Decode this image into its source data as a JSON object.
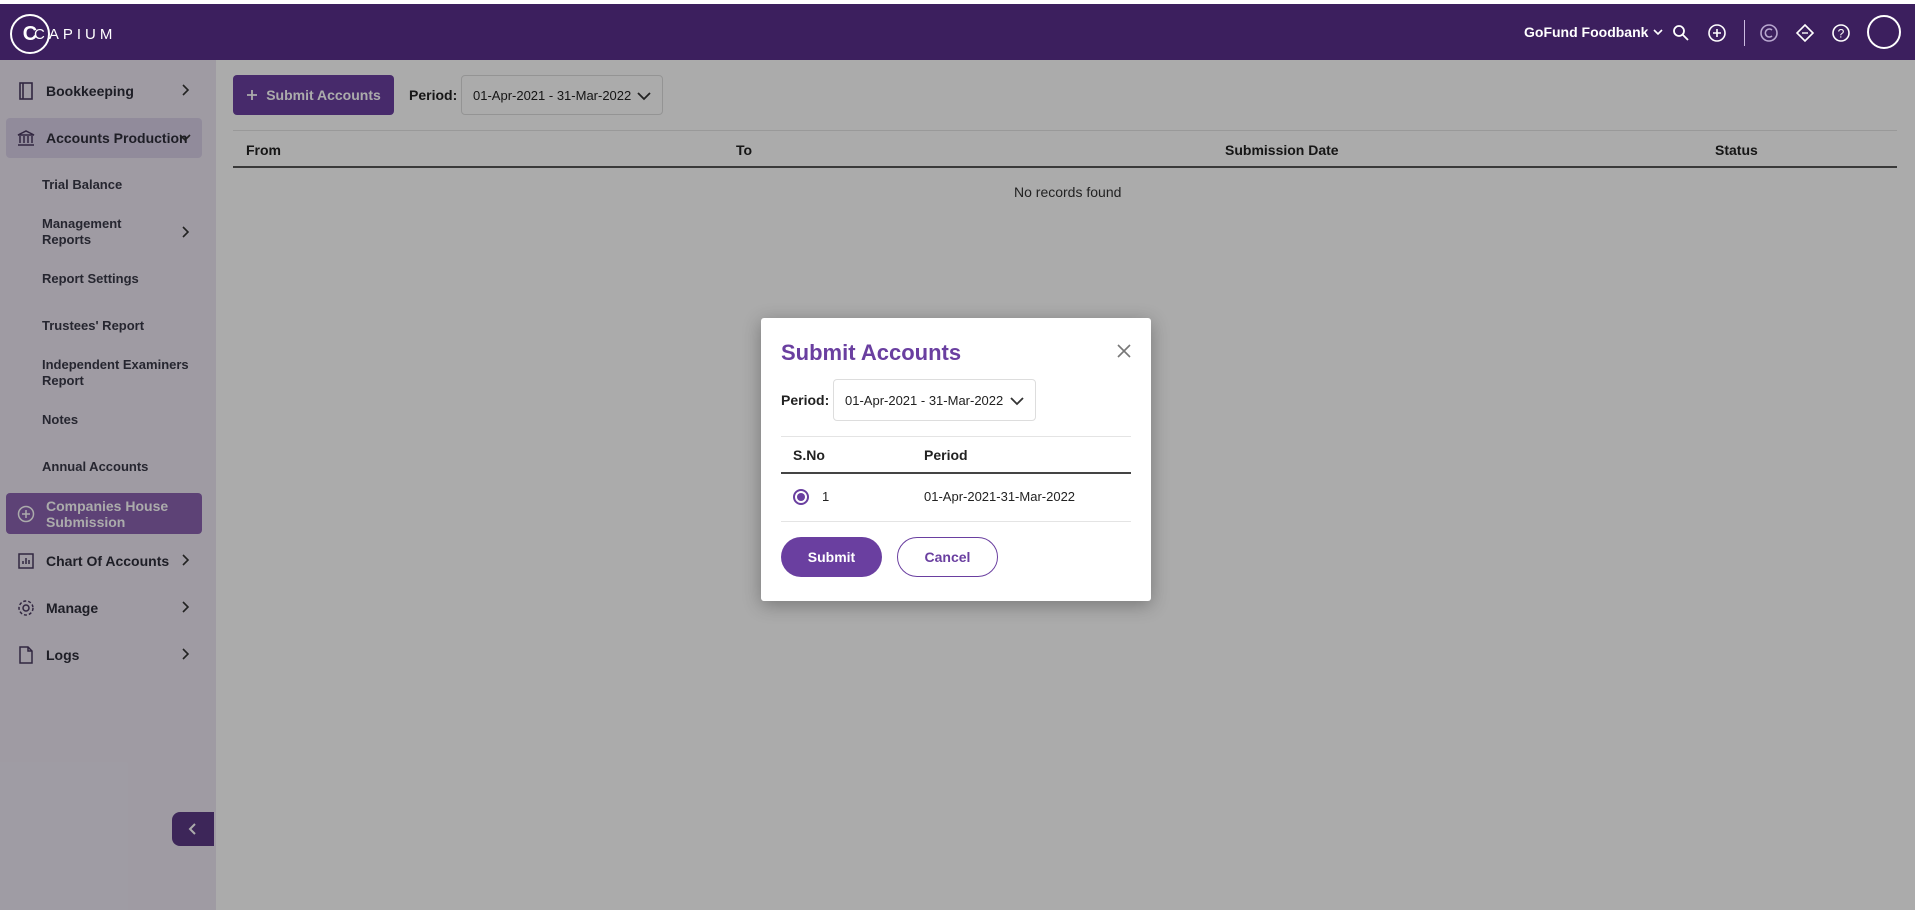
{
  "header": {
    "logo_text": "CAPIUM",
    "org_name": "GoFund Foodbank",
    "icons": [
      "search-icon",
      "add-circle-icon",
      "capium-coin-icon",
      "ticket-icon",
      "help-icon",
      "avatar"
    ]
  },
  "sidebar": {
    "items": [
      {
        "label": "Bookkeeping",
        "icon": "book-icon"
      },
      {
        "label": "Accounts Production",
        "icon": "bank-icon"
      },
      {
        "label": "Companies House Submission",
        "icon": "add-circle-icon"
      },
      {
        "label": "Chart Of Accounts",
        "icon": "chart-icon"
      },
      {
        "label": "Manage",
        "icon": "gear-icon"
      },
      {
        "label": "Logs",
        "icon": "file-icon"
      }
    ],
    "sub_items": [
      {
        "label": "Trial Balance"
      },
      {
        "label": "Management Reports"
      },
      {
        "label": "Report Settings"
      },
      {
        "label": "Trustees' Report"
      },
      {
        "label": "Independent Examiners Report"
      },
      {
        "label": "Notes"
      },
      {
        "label": "Annual Accounts"
      }
    ]
  },
  "main": {
    "submit_button": "Submit Accounts",
    "period_label": "Period:",
    "period_value": "01-Apr-2021 - 31-Mar-2022",
    "columns": [
      "From",
      "To",
      "Submission Date",
      "Status"
    ],
    "empty_text": "No records found"
  },
  "modal": {
    "title": "Submit Accounts",
    "period_label": "Period:",
    "period_value": "01-Apr-2021 - 31-Mar-2022",
    "columns": [
      "S.No",
      "Period"
    ],
    "rows": [
      {
        "sno": "1",
        "period": "01-Apr-2021-31-Mar-2022",
        "selected": true
      }
    ],
    "submit_label": "Submit",
    "cancel_label": "Cancel"
  },
  "colors": {
    "brand": "#3c1f5e",
    "accent": "#6a3fa0",
    "sidebar_bg": "#ede8f4"
  }
}
